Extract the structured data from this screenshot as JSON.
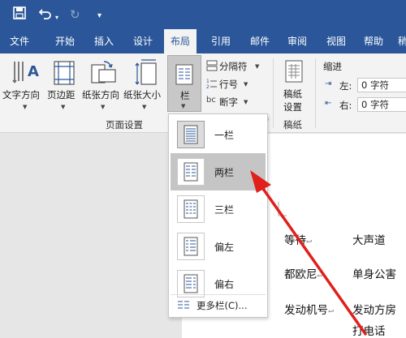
{
  "ribbon_tabs": [
    {
      "label": "文件"
    },
    {
      "label": "开始"
    },
    {
      "label": "插入"
    },
    {
      "label": "设计"
    },
    {
      "label": "布局",
      "active": true
    },
    {
      "label": "引用"
    },
    {
      "label": "邮件"
    },
    {
      "label": "审阅"
    },
    {
      "label": "视图"
    },
    {
      "label": "帮助"
    },
    {
      "label": "稍"
    }
  ],
  "ribbon": {
    "text_direction": "文字方向",
    "margins": "页边距",
    "orientation": "纸张方向",
    "size": "纸张大小",
    "columns": "栏",
    "breaks": "分隔符",
    "line_numbers": "行号",
    "hyphenation": "断字",
    "page_setup_group": "页面设置",
    "manuscript_line1": "稿纸",
    "manuscript_line2": "设置",
    "manuscript_group": "稿纸",
    "indent_title": "缩进",
    "indent_left_label": "左:",
    "indent_left_value": "0 字符",
    "indent_right_label": "右:",
    "indent_right_value": "0 字符"
  },
  "columns_menu": {
    "items": [
      {
        "label": "一栏",
        "selected": true
      },
      {
        "label": "两栏",
        "highlighted": true
      },
      {
        "label": "三栏"
      },
      {
        "label": "偏左"
      },
      {
        "label": "偏右"
      }
    ],
    "more": "更多栏(C)..."
  },
  "document": {
    "cells": [
      "等待",
      "大声道",
      "都欧尼",
      "单身公害",
      "发动机号",
      "发动方房",
      "打电话"
    ],
    "mark": "↩"
  },
  "colors": {
    "brand_blue": "#2b579a",
    "arrow_red": "#e0201b",
    "menu_highlight": "#c5c5c5"
  }
}
